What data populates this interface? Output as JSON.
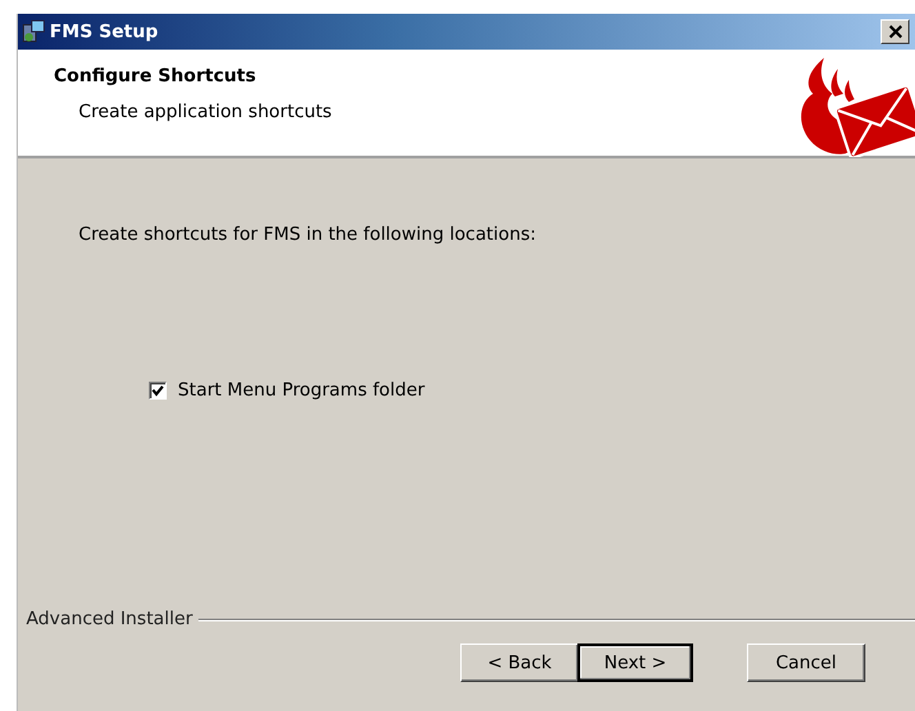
{
  "window": {
    "title": "FMS Setup"
  },
  "header": {
    "title": "Configure Shortcuts",
    "subtitle": "Create application shortcuts"
  },
  "body": {
    "prompt": "Create shortcuts for FMS in the following locations:",
    "options": [
      {
        "label": "Start Menu Programs folder",
        "checked": true
      }
    ]
  },
  "footer": {
    "brand": "Advanced Installer"
  },
  "buttons": [
    {
      "label": "< Back",
      "default": false
    },
    {
      "label": "Next >",
      "default": true
    },
    {
      "label": "Cancel",
      "default": false
    }
  ]
}
